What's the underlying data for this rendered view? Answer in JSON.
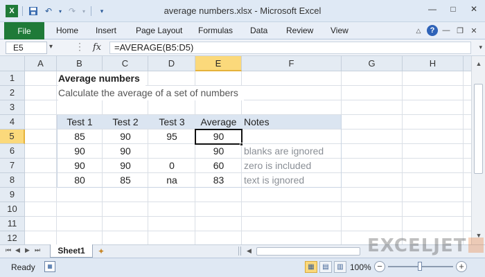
{
  "window": {
    "title": "average numbers.xlsx  -  Microsoft Excel",
    "controls": [
      "minimize-icon",
      "maximize-icon",
      "close-icon"
    ]
  },
  "ribbon": {
    "file_label": "File",
    "tabs": [
      "Home",
      "Insert",
      "Page Layout",
      "Formulas",
      "Data",
      "Review",
      "View"
    ]
  },
  "formula_bar": {
    "name_box": "E5",
    "fx_label": "fx",
    "formula": "=AVERAGE(B5:D5)"
  },
  "grid": {
    "columns": [
      "A",
      "B",
      "C",
      "D",
      "E",
      "F",
      "G",
      "H"
    ],
    "selected_column": "E",
    "rows": [
      "1",
      "2",
      "3",
      "4",
      "5",
      "6",
      "7",
      "8",
      "9",
      "10",
      "11",
      "12"
    ],
    "selected_row": "5",
    "title": "Average numbers",
    "subtitle": "Calculate the average of a set of numbers",
    "table_headers": [
      "Test 1",
      "Test 2",
      "Test 3",
      "Average",
      "Notes"
    ],
    "table_rows": [
      [
        "85",
        "90",
        "95",
        "90",
        ""
      ],
      [
        "90",
        "90",
        "",
        "90",
        "blanks are ignored"
      ],
      [
        "90",
        "90",
        "0",
        "60",
        "zero is included"
      ],
      [
        "80",
        "85",
        "na",
        "83",
        "text is ignored"
      ]
    ],
    "header_fill": "#dbe5f1",
    "selection_fill": "#fbd97b"
  },
  "sheets": {
    "tabs": [
      "Sheet1"
    ],
    "active": "Sheet1"
  },
  "logo": {
    "text": "EXCELJET",
    "accent": "#e76b1c"
  },
  "status": {
    "mode": "Ready",
    "zoom": "100%",
    "zoom_level": 100
  }
}
